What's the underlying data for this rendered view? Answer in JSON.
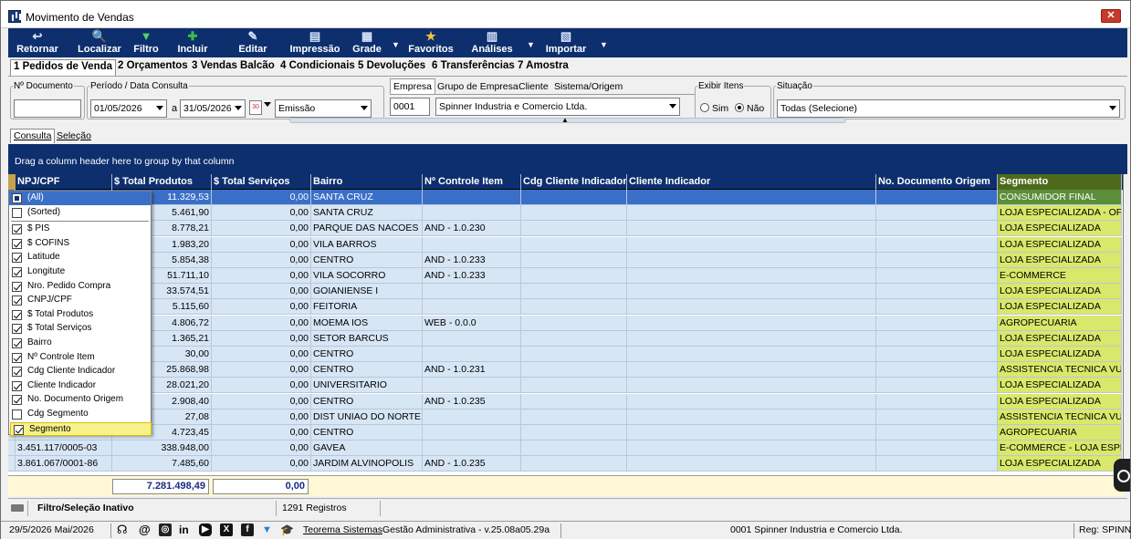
{
  "window": {
    "title": "Movimento de Vendas",
    "close_label": "✕"
  },
  "toolbar": {
    "buttons": [
      {
        "label": "Retornar",
        "icon": "↩"
      },
      {
        "label": "Localizar",
        "icon": "🔍"
      },
      {
        "label": "Filtro",
        "icon": "▼"
      },
      {
        "label": "Incluir",
        "icon": "✚"
      },
      {
        "label": "Editar",
        "icon": "✎"
      },
      {
        "label": "Impressão",
        "icon": "▤"
      },
      {
        "label": "Grade",
        "icon": "▦"
      },
      {
        "label": "Favoritos",
        "icon": "★"
      },
      {
        "label": "Análises",
        "icon": "▥"
      },
      {
        "label": "Importar",
        "icon": "▧"
      }
    ]
  },
  "main_tabs": [
    "1 Pedidos de Venda",
    "2 Orçamentos",
    "3 Vendas Balcão",
    "4 Condicionais",
    "5 Devoluções",
    "6 Transferências",
    "7 Amostra"
  ],
  "filters": {
    "nro_documento_label": "Nº Documento",
    "nro_documento_value": "",
    "periodo_label": "Período / Data Consulta",
    "date_from": "01/05/2026",
    "date_sep": "a",
    "date_to": "31/05/2026",
    "calendar_label": "30",
    "date_type": "Emissão",
    "empresa_tabs": [
      "Empresa",
      "Grupo de Empresa",
      "Cliente",
      "Sistema/Origem"
    ],
    "empresa_code": "0001",
    "empresa_name": "Spinner Industria e Comercio Ltda.",
    "exibir_itens_label": "Exibir Itens",
    "exibir_sim": "Sim",
    "exibir_nao": "Não",
    "situacao_label": "Situação",
    "situacao_value": "Todas (Selecione)"
  },
  "sub_tabs": [
    "Consulta",
    "Seleção"
  ],
  "group_hint": "Drag a column header here to group by that column",
  "grid": {
    "columns": [
      "NPJ/CPF",
      "$ Total Produtos",
      "$ Total Serviços",
      "Bairro",
      "Nº Controle Item",
      "Cdg Cliente Indicador",
      "Cliente Indicador",
      "No. Documento Origem",
      "Segmento"
    ],
    "rows": [
      {
        "cnpj": "",
        "produtos": "11.329,53",
        "servicos": "0,00",
        "bairro": "SANTA CRUZ",
        "controle": "",
        "segmento": "CONSUMIDOR FINAL"
      },
      {
        "cnpj": "",
        "produtos": "5.461,90",
        "servicos": "0,00",
        "bairro": "SANTA CRUZ",
        "controle": "",
        "segmento": "LOJA ESPECIALIZADA - OFIC"
      },
      {
        "cnpj": "",
        "produtos": "8.778,21",
        "servicos": "0,00",
        "bairro": "PARQUE DAS NACOES",
        "controle": "AND - 1.0.230",
        "segmento": "LOJA ESPECIALIZADA"
      },
      {
        "cnpj": "",
        "produtos": "1.983,20",
        "servicos": "0,00",
        "bairro": "VILA BARROS",
        "controle": "",
        "segmento": "LOJA ESPECIALIZADA"
      },
      {
        "cnpj": "",
        "produtos": "5.854,38",
        "servicos": "0,00",
        "bairro": "CENTRO",
        "controle": "AND - 1.0.233",
        "segmento": "LOJA ESPECIALIZADA"
      },
      {
        "cnpj": "",
        "produtos": "51.711,10",
        "servicos": "0,00",
        "bairro": "VILA SOCORRO",
        "controle": "AND - 1.0.233",
        "segmento": "E-COMMERCE"
      },
      {
        "cnpj": "",
        "produtos": "33.574,51",
        "servicos": "0,00",
        "bairro": "GOIANIENSE I",
        "controle": "",
        "segmento": "LOJA ESPECIALIZADA"
      },
      {
        "cnpj": "",
        "produtos": "5.115,60",
        "servicos": "0,00",
        "bairro": "FEITORIA",
        "controle": "",
        "segmento": "LOJA ESPECIALIZADA"
      },
      {
        "cnpj": "",
        "produtos": "4.806,72",
        "servicos": "0,00",
        "bairro": "MOEMA IOS",
        "controle": "WEB - 0.0.0",
        "segmento": "AGROPECUARIA"
      },
      {
        "cnpj": "",
        "produtos": "1.365,21",
        "servicos": "0,00",
        "bairro": "SETOR BARCUS",
        "controle": "",
        "segmento": "LOJA ESPECIALIZADA"
      },
      {
        "cnpj": "",
        "produtos": "30,00",
        "servicos": "0,00",
        "bairro": "CENTRO",
        "controle": "",
        "segmento": "LOJA ESPECIALIZADA"
      },
      {
        "cnpj": "",
        "produtos": "25.868,98",
        "servicos": "0,00",
        "bairro": "CENTRO",
        "controle": "AND - 1.0.231",
        "segmento": "ASSISTENCIA TECNICA VULI"
      },
      {
        "cnpj": "",
        "produtos": "28.021,20",
        "servicos": "0,00",
        "bairro": "UNIVERSITARIO",
        "controle": "",
        "segmento": "LOJA ESPECIALIZADA"
      },
      {
        "cnpj": "",
        "produtos": "2.908,40",
        "servicos": "0,00",
        "bairro": "CENTRO",
        "controle": "AND - 1.0.235",
        "segmento": "LOJA ESPECIALIZADA"
      },
      {
        "cnpj": "",
        "produtos": "27,08",
        "servicos": "0,00",
        "bairro": "DIST UNIAO DO NORTE",
        "controle": "",
        "segmento": "ASSISTENCIA TECNICA VULI"
      },
      {
        "cnpj": "",
        "produtos": "4.723,45",
        "servicos": "0,00",
        "bairro": "CENTRO",
        "controle": "",
        "segmento": "AGROPECUARIA"
      },
      {
        "cnpj": "3.451.117/0005-03",
        "produtos": "338.948,00",
        "servicos": "0,00",
        "bairro": "GAVEA",
        "controle": "",
        "segmento": "E-COMMERCE - LOJA ESPEC"
      },
      {
        "cnpj": "3.861.067/0001-86",
        "produtos": "7.485,60",
        "servicos": "0,00",
        "bairro": "JARDIM ALVINOPOLIS",
        "controle": "AND - 1.0.235",
        "segmento": "LOJA ESPECIALIZADA"
      }
    ],
    "total_produtos": "7.281.498,49",
    "total_servicos": "0,00"
  },
  "column_chooser": {
    "items": [
      {
        "label": "(All)",
        "state": "partial"
      },
      {
        "label": "(Sorted)",
        "state": "off"
      },
      {
        "label": "$ PIS",
        "state": "on"
      },
      {
        "label": "$ COFINS",
        "state": "on"
      },
      {
        "label": "Latitude",
        "state": "on"
      },
      {
        "label": "Longitute",
        "state": "on"
      },
      {
        "label": "Nro. Pedido Compra",
        "state": "on"
      },
      {
        "label": "CNPJ/CPF",
        "state": "on"
      },
      {
        "label": "$ Total Produtos",
        "state": "on"
      },
      {
        "label": "$ Total Serviços",
        "state": "on"
      },
      {
        "label": "Bairro",
        "state": "on"
      },
      {
        "label": "Nº Controle Item",
        "state": "on"
      },
      {
        "label": "Cdg Cliente Indicador",
        "state": "on"
      },
      {
        "label": "Cliente Indicador",
        "state": "on"
      },
      {
        "label": "No. Documento Origem",
        "state": "on"
      },
      {
        "label": "Cdg Segmento",
        "state": "off"
      },
      {
        "label": "Segmento",
        "state": "on"
      }
    ]
  },
  "status": {
    "filter_state": "Filtro/Seleção Inativo",
    "records": "1291 Registros"
  },
  "bottom": {
    "date": "29/5/2026 Mai/2026",
    "company_link": "Teorema Sistemas",
    "product": "Gestão Administrativa - v.25.08a05.29a",
    "empresa": "0001 Spinner Industria e Comercio Ltda.",
    "reg": "Reg: SPINN"
  }
}
